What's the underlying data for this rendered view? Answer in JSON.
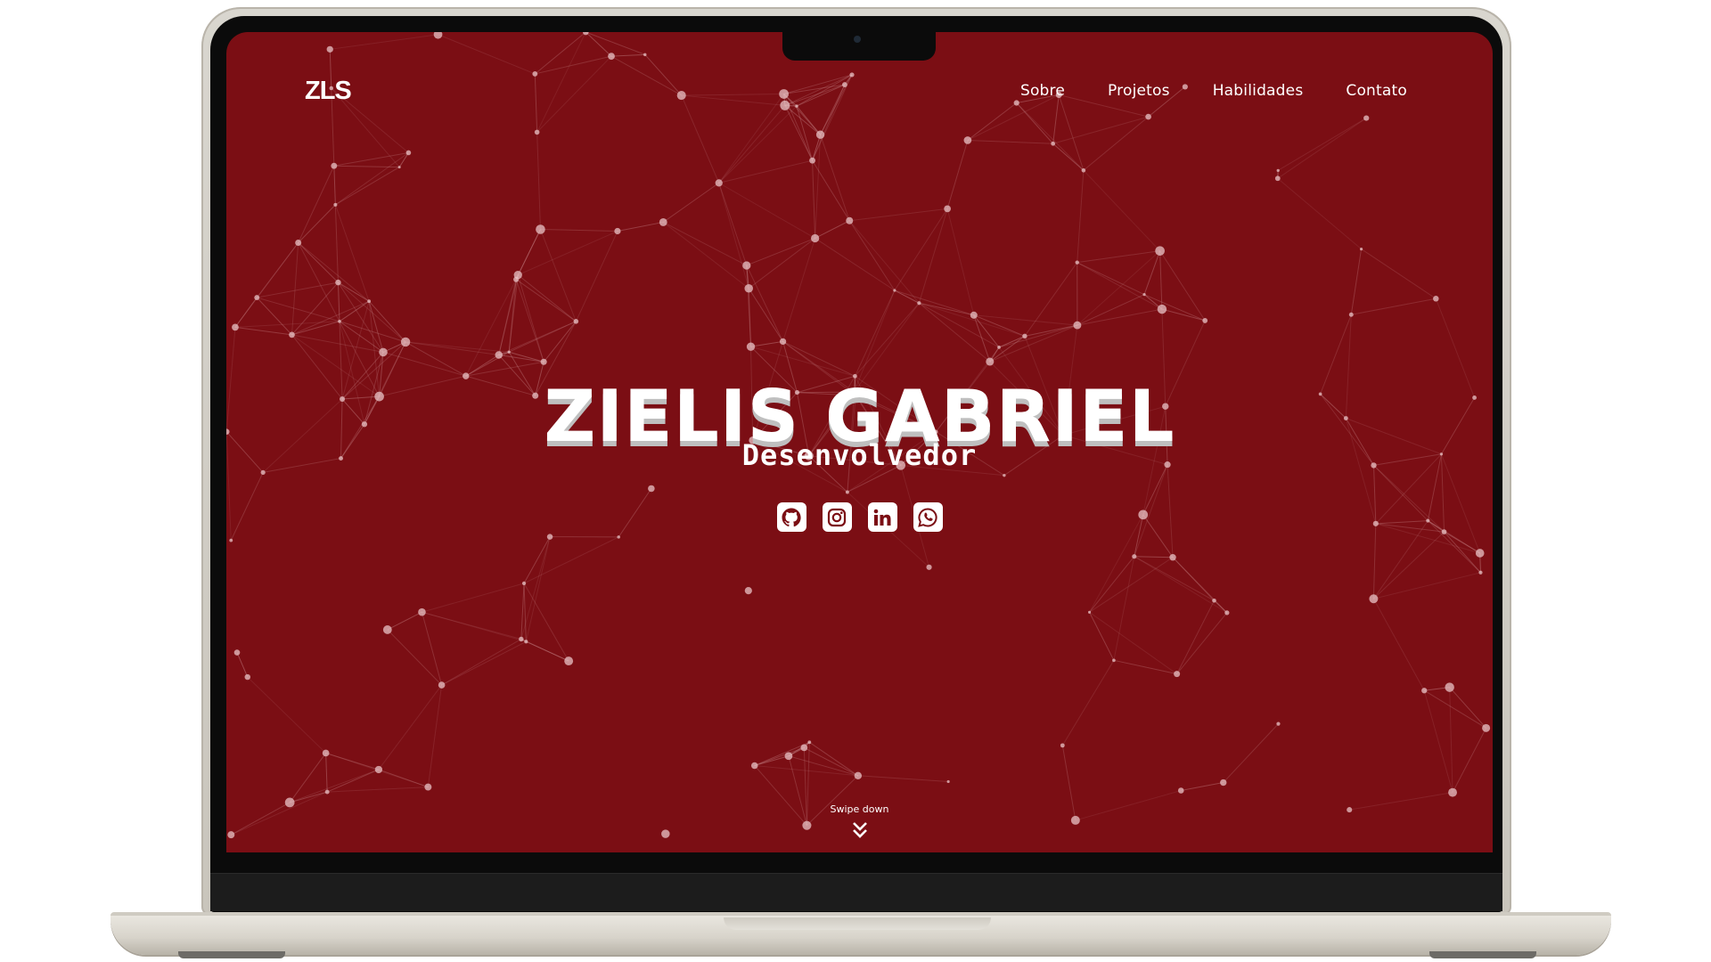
{
  "site": {
    "logo": "ZLS",
    "nav": [
      "Sobre",
      "Projetos",
      "Habilidades",
      "Contato"
    ]
  },
  "hero": {
    "title": "ZIELIS GABRIEL",
    "subtitle": "Desenvolvedor",
    "socials": [
      {
        "name": "github-icon"
      },
      {
        "name": "instagram-icon"
      },
      {
        "name": "linkedin-icon"
      },
      {
        "name": "whatsapp-icon"
      }
    ],
    "swipe_label": "Swipe down"
  },
  "theme": {
    "background": "#7b0e14",
    "text": "#ffffff",
    "network_line": "#c98a8d",
    "network_dot": "#e8c3c5"
  }
}
